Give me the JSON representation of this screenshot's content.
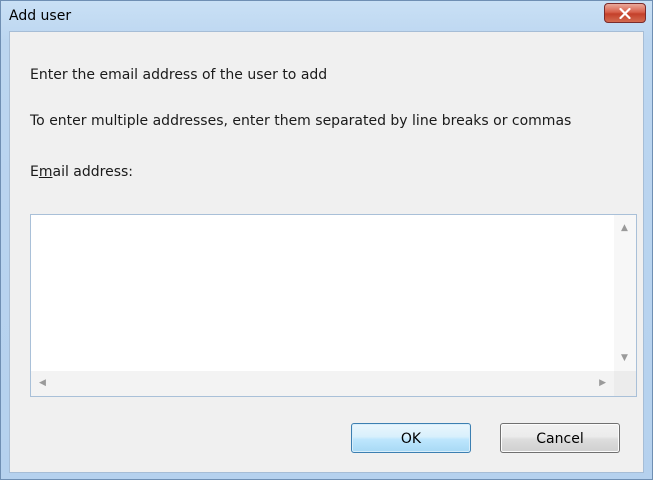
{
  "window": {
    "title": "Add user"
  },
  "dialog": {
    "instruction": "Enter the email address of the user to add",
    "multiple_hint": "To enter multiple addresses, enter them separated by line breaks or commas",
    "email_label_prefix": "E",
    "email_label_mnemonic": "m",
    "email_label_suffix": "ail address:",
    "email_value": ""
  },
  "buttons": {
    "ok": "OK",
    "cancel": "Cancel"
  },
  "icons": {
    "close": "close-icon",
    "scroll_up": "▲",
    "scroll_down": "▼",
    "scroll_left": "◀",
    "scroll_right": "▶"
  },
  "colors": {
    "title_gradient_top": "#c9e0f5",
    "client_background": "#f0f0f0",
    "close_button": "#c4402a",
    "ok_border": "#3c7fb1"
  }
}
